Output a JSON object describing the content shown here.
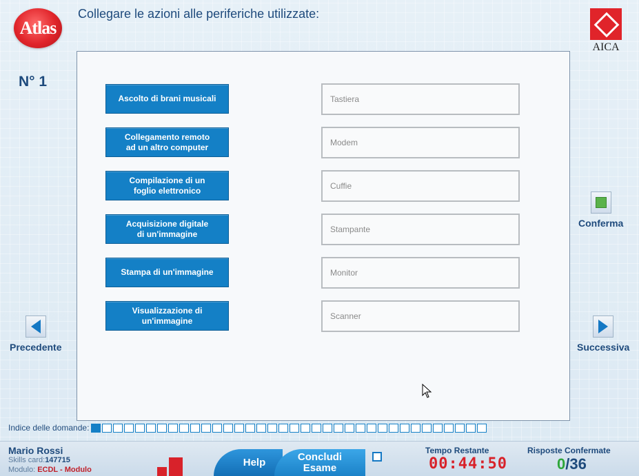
{
  "header": {
    "question": "Collegare le azioni alle periferiche utilizzate:",
    "question_number": "N° 1",
    "atlas_logo": "Atlas",
    "aica_logo": "AICA"
  },
  "actions": [
    "Ascolto di brani musicali",
    "Collegamento remoto\nad un altro computer",
    "Compilazione di un\nfoglio elettronico",
    "Acquisizione digitale\ndi un'immagine",
    "Stampa di un'immagine",
    "Visualizzazione di\nun'immagine"
  ],
  "devices": [
    "Tastiera",
    "Modem",
    "Cuffie",
    "Stampante",
    "Monitor",
    "Scanner"
  ],
  "nav": {
    "confirm": "Conferma",
    "prev": "Precedente",
    "next": "Successiva"
  },
  "index": {
    "label": "Indice delle domande:",
    "total": 36,
    "current": 1
  },
  "footer": {
    "user_name": "Mario Rossi",
    "skills_label": "Skills card:",
    "skills_value": "147715",
    "modulo_label": "Modulo:",
    "modulo_value": "ECDL - Modulo",
    "help": "Help",
    "concludi": "Concludi\nEsame",
    "time_label": "Tempo Restante",
    "time_value": "00:44:50",
    "resp_label": "Risposte Confermate",
    "resp_done": "0",
    "resp_total": "/36"
  },
  "icons": {
    "prev": "arrow-left-icon",
    "next": "arrow-right-icon",
    "confirm": "green-square-icon",
    "cursor": "mouse-pointer-icon"
  },
  "colors": {
    "action_bg": "#1480c6",
    "time_red": "#d8222a",
    "confirmed_green": "#2ea63a"
  }
}
